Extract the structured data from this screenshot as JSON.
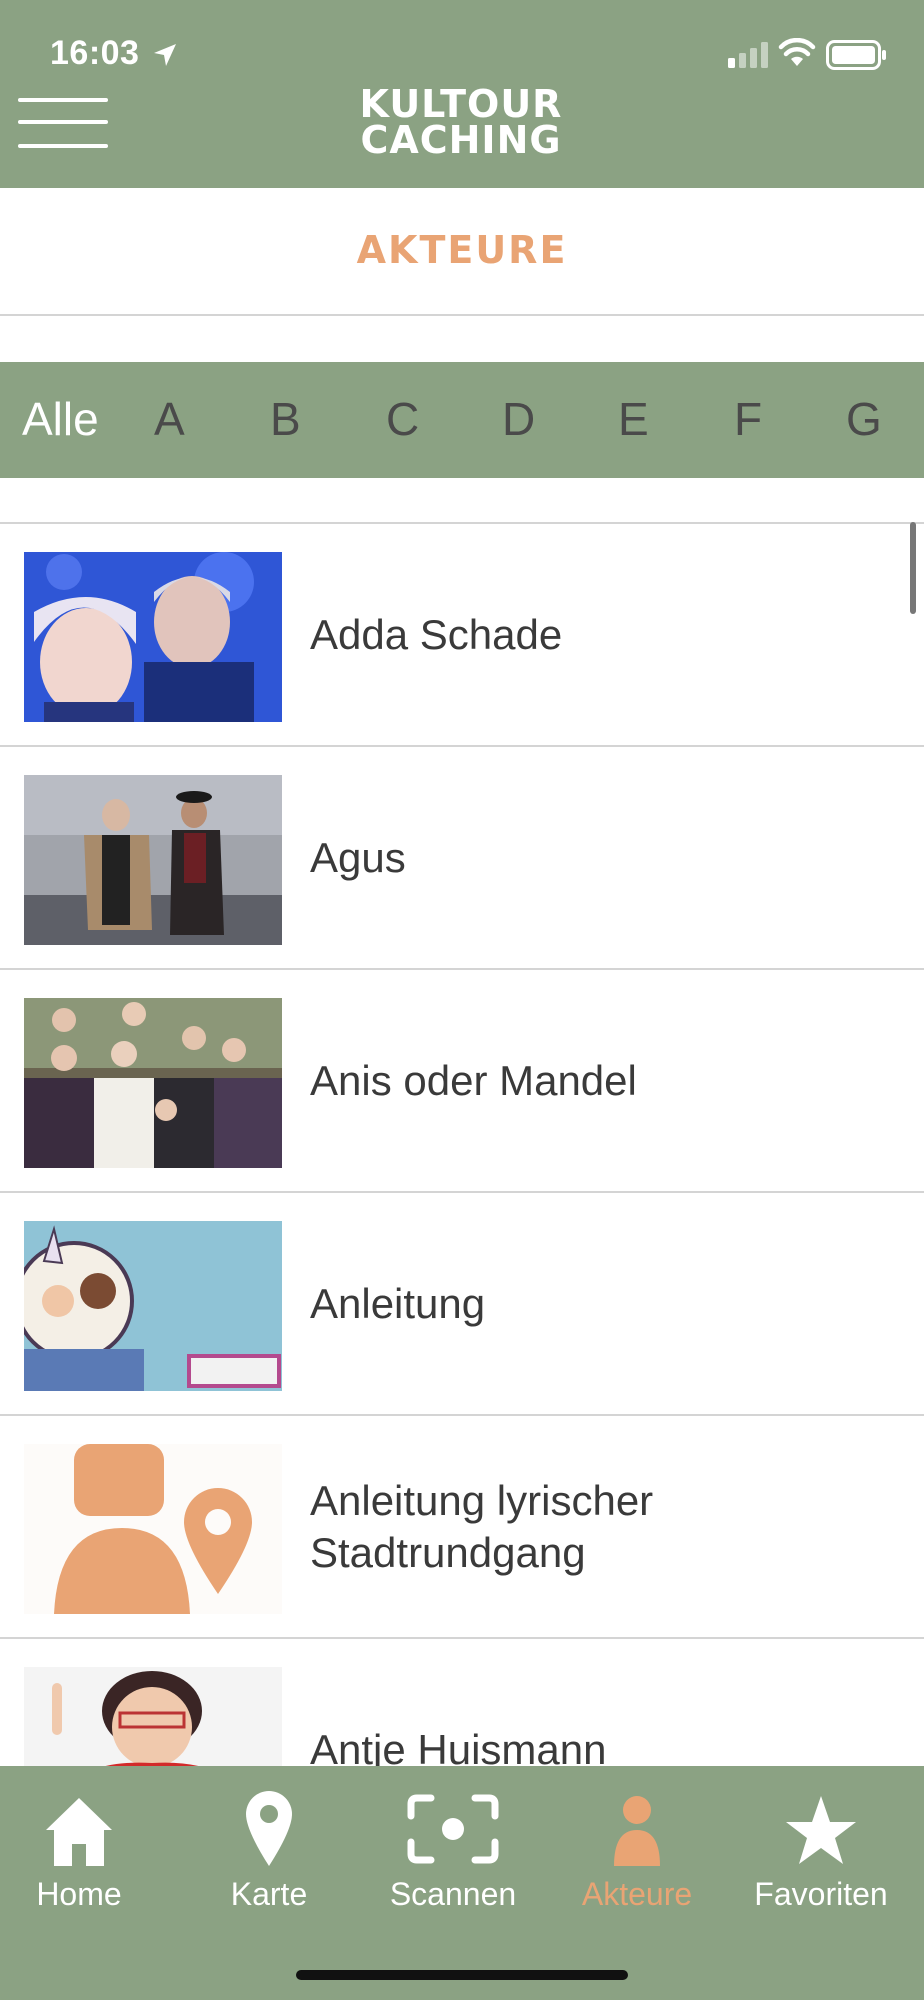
{
  "status_bar": {
    "time": "16:03"
  },
  "header": {
    "logo_line1": "KULTOUR",
    "logo_line2": "CACHING"
  },
  "page": {
    "title": "AKTEURE"
  },
  "letters": [
    "Alle",
    "A",
    "B",
    "C",
    "D",
    "E",
    "F",
    "G"
  ],
  "active_letter": "Alle",
  "actors": [
    {
      "name": "Adda Schade",
      "thumb": "photo-two-people-blue"
    },
    {
      "name": "Agus",
      "thumb": "photo-two-men-street"
    },
    {
      "name": "Anis oder Mandel",
      "thumb": "photo-group-women"
    },
    {
      "name": "Anleitung",
      "thumb": "illustration-paderdetektive"
    },
    {
      "name": "Anleitung lyrischer Stadtrundgang",
      "thumb": "placeholder-person-pin-icon"
    },
    {
      "name": "Antje Huismann",
      "thumb": "photo-woman-red-dress"
    }
  ],
  "tabs": [
    {
      "label": "Home",
      "icon": "home-icon"
    },
    {
      "label": "Karte",
      "icon": "map-pin-icon"
    },
    {
      "label": "Scannen",
      "icon": "scan-icon"
    },
    {
      "label": "Akteure",
      "icon": "person-icon"
    },
    {
      "label": "Favoriten",
      "icon": "star-icon"
    }
  ],
  "active_tab": "Akteure",
  "colors": {
    "primary": "#8ba283",
    "accent": "#e9a474",
    "text": "#3a3a3a",
    "divider": "#d4d4d4"
  }
}
